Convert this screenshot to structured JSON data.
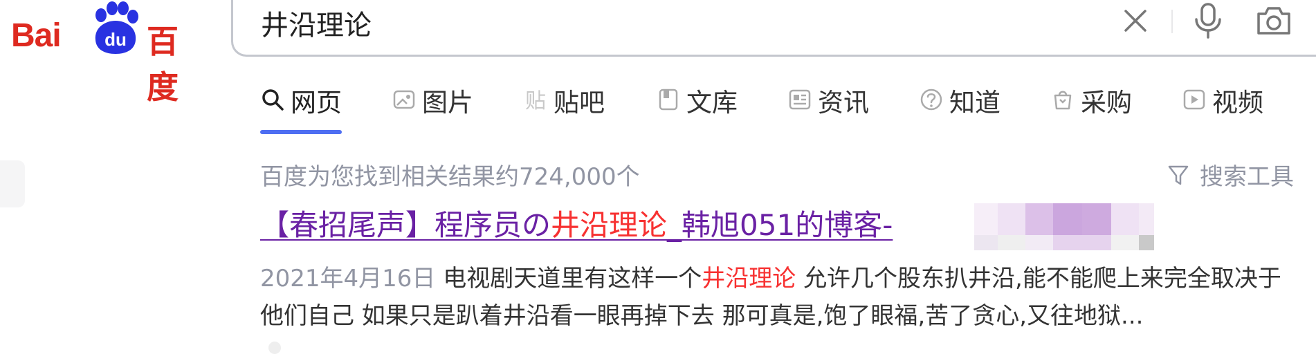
{
  "logo": {
    "bai": "Bai",
    "du": "du",
    "cn": "百度"
  },
  "search": {
    "query": "井沿理论"
  },
  "tabs": [
    {
      "label": "网页",
      "icon": "search-icon",
      "active": true
    },
    {
      "label": "图片",
      "icon": "image-icon"
    },
    {
      "label": "贴吧",
      "icon": "tieba-icon"
    },
    {
      "label": "文库",
      "icon": "document-icon"
    },
    {
      "label": "资讯",
      "icon": "news-icon"
    },
    {
      "label": "知道",
      "icon": "question-icon"
    },
    {
      "label": "采购",
      "icon": "shopping-icon"
    },
    {
      "label": "视频",
      "icon": "video-icon"
    }
  ],
  "stats": {
    "text": "百度为您找到相关结果约724,000个"
  },
  "tools": {
    "label": "搜索工具",
    "icon": "filter-icon"
  },
  "result": {
    "title_before": "【春招尾声】程序员の",
    "title_highlight": "井沿理论",
    "title_after": "_韩旭051的博客-",
    "date": "2021年4月16日",
    "abstract_before": "电视剧天道里有这样一个",
    "abstract_highlight": "井沿理论",
    "abstract_after": "允许几个股东扒井沿,能不能爬上来完全取决于他们自己 如果只是趴着井沿看一眼再掉下去 那可真是,饱了眼福,苦了贪心,又往地狱..."
  },
  "colors": {
    "brand_red": "#de2a20",
    "brand_blue": "#2932e1",
    "tab_active": "#4e6ef2",
    "visited_link": "#6a21a4",
    "highlight": "#f73131",
    "muted": "#9195a3"
  }
}
